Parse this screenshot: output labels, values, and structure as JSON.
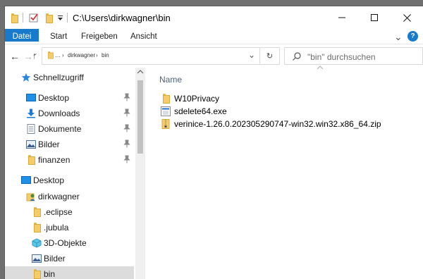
{
  "titlebar": {
    "path": "C:\\Users\\dirkwagner\\bin",
    "quick_icons": [
      "folder-icon",
      "properties-check-icon",
      "new-folder-icon",
      "dropdown-arrow-icon"
    ],
    "minimize": "—",
    "maximize": "☐",
    "close": "✕"
  },
  "ribbon": {
    "tabs": [
      "Datei",
      "Start",
      "Freigeben",
      "Ansicht"
    ],
    "expand": "⌄",
    "help": "?"
  },
  "address": {
    "back": "←",
    "forward": "→",
    "up": "↑",
    "history": "⌄",
    "crumbs": [
      "…",
      "›",
      "dirkwagner",
      "›",
      "bin"
    ],
    "dropdown": "⌄",
    "refresh": "↻",
    "search_placeholder": "\"bin\" durchsuchen"
  },
  "nav": {
    "quick_access": "Schnellzugriff",
    "pinned": [
      {
        "label": "Desktop",
        "icon": "desktop-icon"
      },
      {
        "label": "Downloads",
        "icon": "download-icon"
      },
      {
        "label": "Dokumente",
        "icon": "documents-icon"
      },
      {
        "label": "Bilder",
        "icon": "pictures-icon"
      },
      {
        "label": "finanzen",
        "icon": "folder-icon"
      }
    ],
    "desktop": "Desktop",
    "user": "dirkwagner",
    "user_children": [
      {
        "label": ".eclipse",
        "icon": "folder-icon"
      },
      {
        "label": ".jubula",
        "icon": "folder-icon"
      },
      {
        "label": "3D-Objekte",
        "icon": "3d-objects-icon"
      },
      {
        "label": "Bilder",
        "icon": "pictures-icon"
      },
      {
        "label": "bin",
        "icon": "folder-icon",
        "selected": true
      }
    ]
  },
  "content": {
    "column_name": "Name",
    "files": [
      {
        "name": "W10Privacy",
        "icon": "folder-icon"
      },
      {
        "name": "sdelete64.exe",
        "icon": "exe-icon"
      },
      {
        "name": "verinice-1.26.0.202305290747-win32.win32.x86_64.zip",
        "icon": "zip-icon"
      }
    ]
  },
  "colors": {
    "accent": "#1979ca",
    "selected_bg": "#dcdcdc",
    "folder": "#f4cd6a"
  }
}
